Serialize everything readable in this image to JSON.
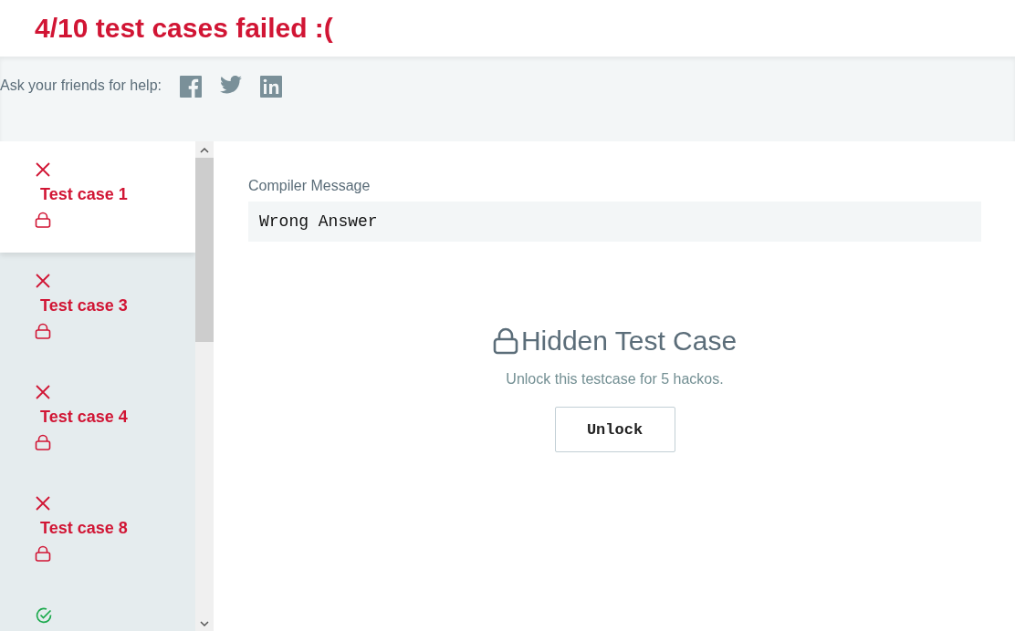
{
  "heading": "4/10 test cases failed :(",
  "share": {
    "label": "Ask your friends for help:",
    "networks": [
      {
        "kind": "facebook"
      },
      {
        "kind": "twitter"
      },
      {
        "kind": "linkedin"
      }
    ]
  },
  "test_cases": [
    {
      "label": "Test case 1",
      "kind": "failed",
      "locked": true,
      "selected": true
    },
    {
      "label": "Test case 3",
      "kind": "failed",
      "locked": true,
      "selected": false
    },
    {
      "label": "Test case 4",
      "kind": "failed",
      "locked": true,
      "selected": false
    },
    {
      "label": "Test case 8",
      "kind": "failed",
      "locked": true,
      "selected": false
    },
    {
      "kind": "passed",
      "selected": false
    }
  ],
  "compiler": {
    "label": "Compiler Message",
    "message": "Wrong Answer"
  },
  "hidden": {
    "title": "Hidden Test Case",
    "text": "Unlock this testcase for 5 hackos.",
    "button": "Unlock"
  }
}
